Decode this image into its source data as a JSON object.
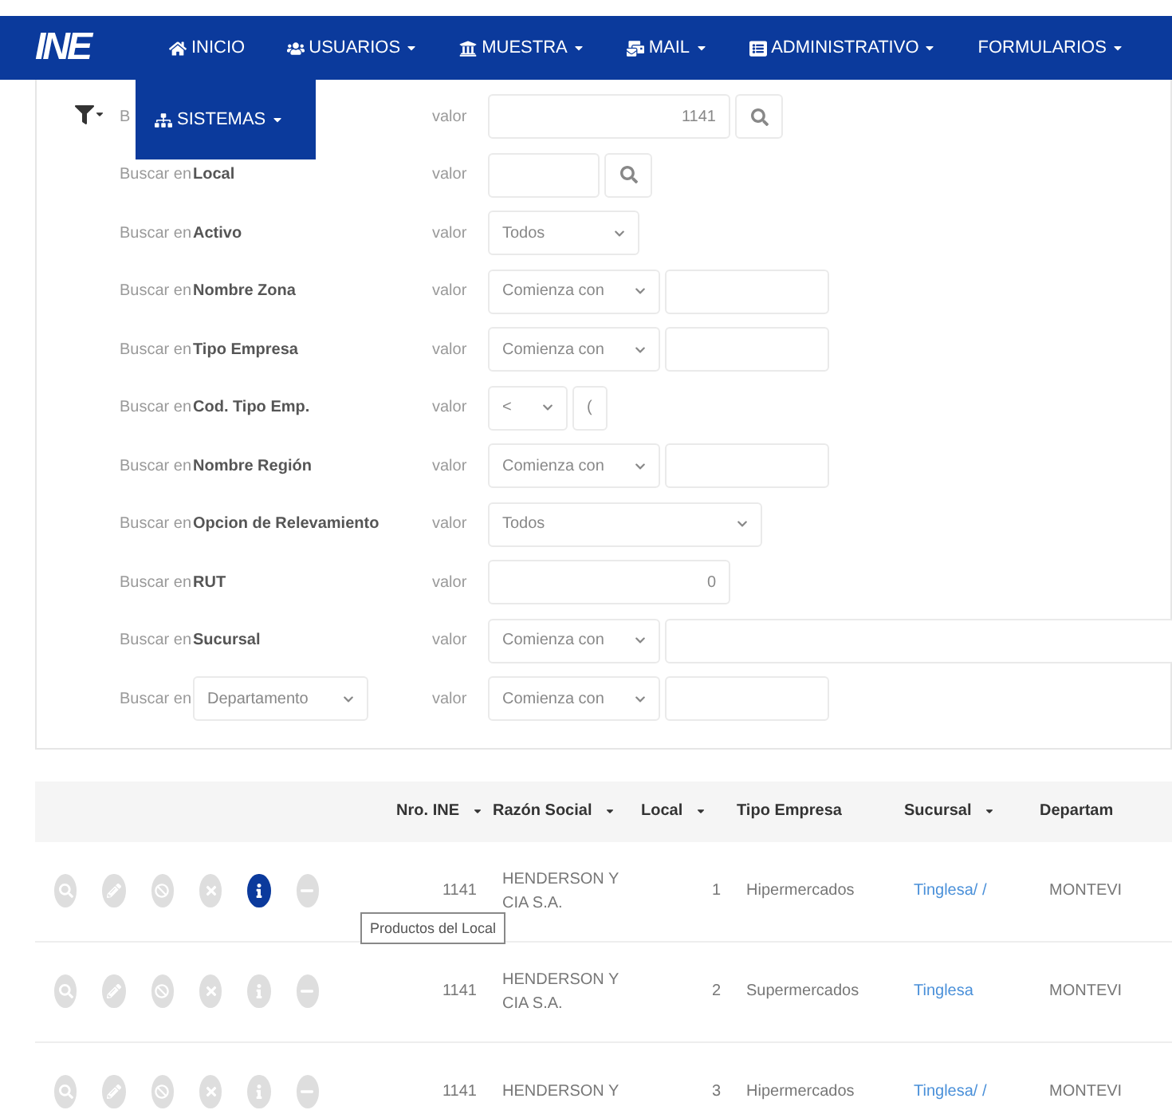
{
  "navbar": {
    "logo": "INE",
    "items": [
      {
        "kind": "home",
        "label": "INICIO",
        "dropdown": false
      },
      {
        "kind": "users",
        "label": "USUARIOS",
        "dropdown": true
      },
      {
        "kind": "bank",
        "label": "MUESTRA",
        "dropdown": true
      },
      {
        "kind": "mail",
        "label": "MAIL",
        "dropdown": true
      },
      {
        "kind": "list",
        "label": "ADMINISTRATIVO",
        "dropdown": true
      },
      {
        "kind": "none",
        "label": "FORMULARIOS",
        "dropdown": true
      }
    ],
    "open_menu": {
      "items": [
        {
          "kind": "sitemap",
          "label": "SISTEMAS",
          "dropdown": true
        }
      ]
    }
  },
  "filters": [
    {
      "label": "B",
      "valor": "valor",
      "controls": [
        {
          "kind": "number-input",
          "value": "1141"
        },
        {
          "kind": "search-button"
        }
      ]
    },
    {
      "label": "Buscar en",
      "field": "Local",
      "valor": "valor",
      "controls": [
        {
          "kind": "short-input"
        },
        {
          "kind": "search-button"
        }
      ]
    },
    {
      "label": "Buscar en",
      "field": "Activo",
      "valor": "valor",
      "controls": [
        {
          "kind": "select",
          "value": "Todos"
        }
      ]
    },
    {
      "label": "Buscar en",
      "field": "Nombre Zona",
      "valor": "valor",
      "controls": [
        {
          "kind": "match-select",
          "value": "Comienza con"
        },
        {
          "kind": "text-input"
        }
      ]
    },
    {
      "label": "Buscar en",
      "field": "Tipo Empresa",
      "valor": "valor",
      "controls": [
        {
          "kind": "match-select",
          "value": "Comienza con"
        },
        {
          "kind": "text-input"
        }
      ]
    },
    {
      "label": "Buscar en",
      "field": "Cod. Tipo Emp.",
      "valor": "valor",
      "controls": [
        {
          "kind": "operator-select",
          "value": "<"
        },
        {
          "kind": "char-input",
          "value": "("
        }
      ]
    },
    {
      "label": "Buscar en",
      "field": "Nombre Región",
      "valor": "valor",
      "controls": [
        {
          "kind": "match-select",
          "value": "Comienza con"
        },
        {
          "kind": "text-input"
        }
      ]
    },
    {
      "label": "Buscar en",
      "field": "Opcion de Relevamiento",
      "valor": "valor",
      "controls": [
        {
          "kind": "long-select",
          "value": "Todos"
        }
      ]
    },
    {
      "label": "Buscar en",
      "field": "RUT",
      "valor": "valor",
      "controls": [
        {
          "kind": "number-input",
          "value": "0"
        }
      ]
    },
    {
      "label": "Buscar en",
      "field": "Sucursal",
      "valor": "valor",
      "controls": [
        {
          "kind": "match-select",
          "value": "Comienza con"
        },
        {
          "kind": "long-input"
        }
      ]
    },
    {
      "label": "Buscar en",
      "field_select": "Departamento",
      "valor": "valor",
      "controls": [
        {
          "kind": "match-select",
          "value": "Comienza con"
        },
        {
          "kind": "text-input"
        }
      ]
    }
  ],
  "table": {
    "columns": [
      {
        "label": "Nro. INE",
        "sortable": true
      },
      {
        "label": "Razón Social",
        "sortable": true
      },
      {
        "label": "Local",
        "sortable": true
      },
      {
        "label": "Tipo Empresa",
        "sortable": false
      },
      {
        "label": "Sucursal",
        "sortable": true
      },
      {
        "label": "Departam"
      }
    ],
    "rows": [
      {
        "actions": [
          {
            "kind": "search",
            "selected": false
          },
          {
            "kind": "edit",
            "selected": false
          },
          {
            "kind": "ban",
            "selected": false
          },
          {
            "kind": "close",
            "selected": false
          },
          {
            "kind": "info",
            "selected": true
          },
          {
            "kind": "minus",
            "selected": false
          }
        ],
        "tooltip": "Productos del Local",
        "cells": [
          "1141",
          "HENDERSON Y CIA S.A.",
          "1",
          "Hipermercados",
          "Tinglesa/ /",
          "MONTEVI"
        ]
      },
      {
        "actions": [
          {
            "kind": "search",
            "selected": false
          },
          {
            "kind": "edit",
            "selected": false
          },
          {
            "kind": "ban",
            "selected": false
          },
          {
            "kind": "close",
            "selected": false
          },
          {
            "kind": "info",
            "selected": false
          },
          {
            "kind": "minus",
            "selected": false
          }
        ],
        "cells": [
          "1141",
          "HENDERSON Y CIA S.A.",
          "2",
          "Supermercados",
          "Tinglesa",
          "MONTEVI"
        ]
      },
      {
        "actions": [
          {
            "kind": "search",
            "selected": false
          },
          {
            "kind": "edit",
            "selected": false
          },
          {
            "kind": "ban",
            "selected": false
          },
          {
            "kind": "close",
            "selected": false
          },
          {
            "kind": "info",
            "selected": false
          },
          {
            "kind": "minus",
            "selected": false
          }
        ],
        "cells": [
          "1141",
          "HENDERSON Y",
          "3",
          "Hipermercados",
          "Tinglesa/ /",
          "MONTEVI"
        ]
      }
    ]
  }
}
